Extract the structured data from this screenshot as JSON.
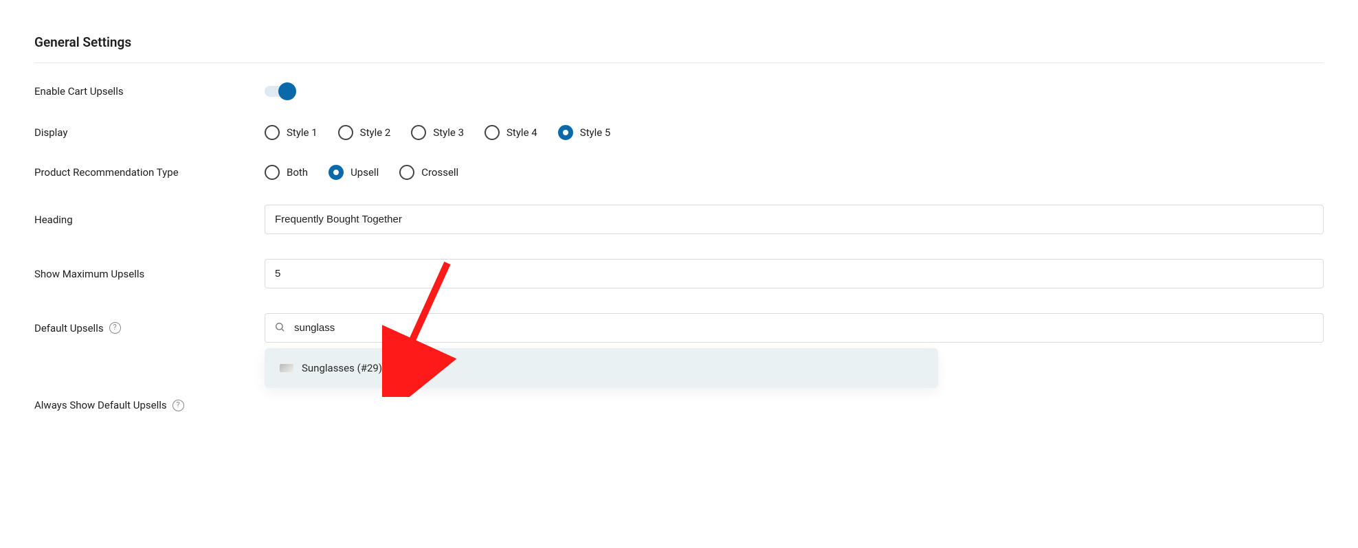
{
  "section_title": "General Settings",
  "rows": {
    "enable_cart_upsells": {
      "label": "Enable Cart Upsells",
      "on": true
    },
    "display": {
      "label": "Display",
      "options": [
        "Style 1",
        "Style 2",
        "Style 3",
        "Style 4",
        "Style 5"
      ],
      "selected_index": 4
    },
    "product_recommendation": {
      "label": "Product Recommendation Type",
      "options": [
        "Both",
        "Upsell",
        "Crossell"
      ],
      "selected_index": 1
    },
    "heading": {
      "label": "Heading",
      "value": "Frequently Bought Together"
    },
    "max_upsells": {
      "label": "Show Maximum Upsells",
      "value": "5"
    },
    "default_upsells": {
      "label": "Default Upsells",
      "search_value": "sunglass",
      "dropdown_result": "Sunglasses (#29)"
    },
    "always_show": {
      "label": "Always Show Default Upsells"
    }
  },
  "colors": {
    "accent": "#0a69a8"
  }
}
